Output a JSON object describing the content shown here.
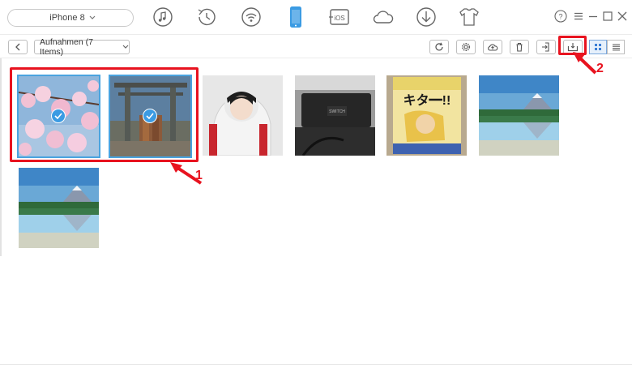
{
  "device": {
    "name": "iPhone 8"
  },
  "top_icons": [
    "music-icon",
    "history-icon",
    "wifi-icon",
    "phone-icon",
    "ios-icon",
    "cloud-icon",
    "download-icon",
    "shirt-icon"
  ],
  "window": {
    "help": "?"
  },
  "toolbar": {
    "album_label": "Aufnahmen (7 Items)"
  },
  "photos": [
    {
      "name": "cherry-blossom",
      "selected": true
    },
    {
      "name": "shrine-gate",
      "selected": true
    },
    {
      "name": "person-hood",
      "selected": false
    },
    {
      "name": "nintendo-switch",
      "selected": false
    },
    {
      "name": "manga-book",
      "selected": false
    },
    {
      "name": "lake-mountain",
      "selected": false
    },
    {
      "name": "lake-mountain-2",
      "selected": false
    }
  ],
  "annotations": {
    "callout_1": "1",
    "callout_2": "2"
  },
  "colors": {
    "accent": "#3b9be3",
    "annotation": "#e8131f",
    "active_phone": "#3b9be3"
  }
}
